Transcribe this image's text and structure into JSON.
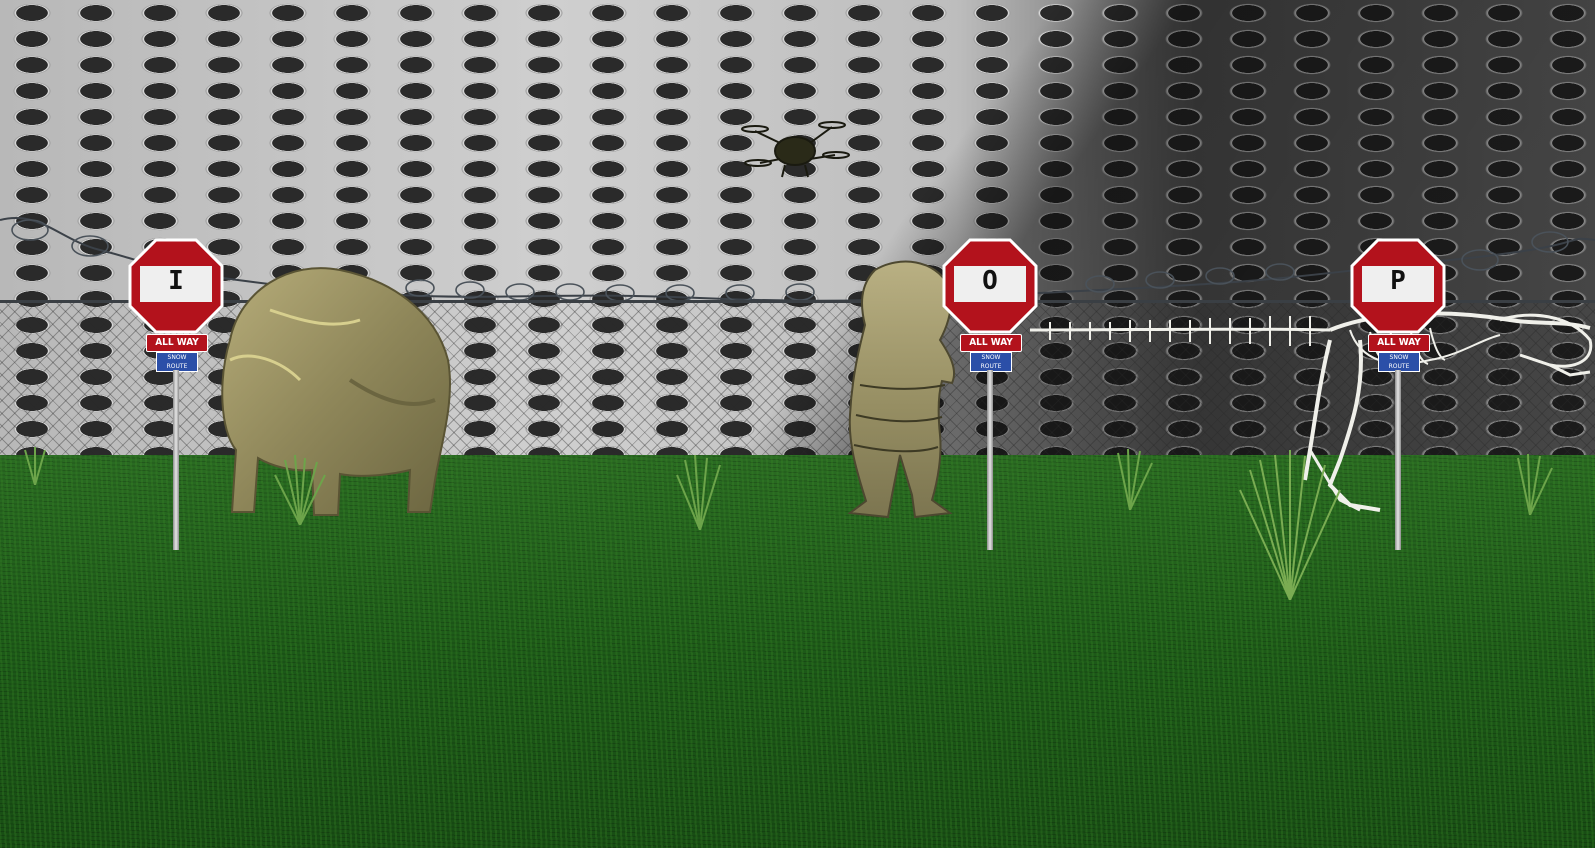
{
  "scene": {
    "signs": [
      {
        "letter": "I",
        "plate": "ALL WAY",
        "route_sign": "SNOW ROUTE"
      },
      {
        "letter": "O",
        "plate": "ALL WAY",
        "route_sign": "SNOW ROUTE"
      },
      {
        "letter": "P",
        "plate": "ALL WAY",
        "route_sign": "SNOW ROUTE"
      }
    ],
    "colors": {
      "stop_red": "#b3121c",
      "grass": "#1e5c19",
      "wall": "#8a8a8a",
      "route_blue": "#2b4fa8"
    }
  }
}
